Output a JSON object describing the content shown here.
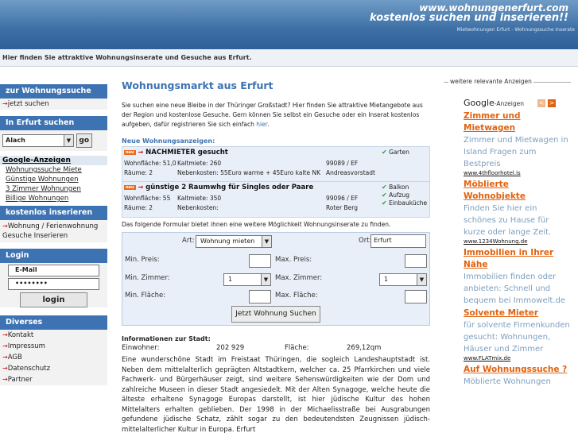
{
  "header": {
    "domain": "www.wohnungenerfurt.com",
    "slogan": "kostenlos suchen und inserieren!!",
    "tagline": "Mietwohnungen Erfurt - Wohnungssuche Inserate",
    "subtitle": "Hier finden Sie attraktive Wohnungsinserate und Gesuche aus Erfurt."
  },
  "sidebar": {
    "search": {
      "title": "zur Wohnungssuche",
      "link": "jetzt suchen"
    },
    "city": {
      "title": "In Erfurt suchen",
      "selected": "Alach",
      "go": "go"
    },
    "google": {
      "title": "Google-Anzeigen",
      "links": [
        "Wohnungssuche Miete",
        "Günstige Wohnungen",
        "3 Zimmer Wohnungen",
        "Billige Wohnungen"
      ]
    },
    "insert": {
      "title": "kostenlos inserieren",
      "link": "Wohnung / Ferienwohnung Gesuche Inserieren"
    },
    "login": {
      "title": "Login",
      "email_placeholder": "E-Mail",
      "password": "••••••••",
      "button": "login"
    },
    "misc": {
      "title": "Diverses",
      "links": [
        "Kontakt",
        "Impressum",
        "AGB",
        "Datenschutz",
        "Partner"
      ]
    }
  },
  "main": {
    "title": "Wohnungsmarkt aus Erfurt",
    "intro": "Sie suchen eine neue Bleibe in der Thüringer Großstadt? Hier finden Sie attraktive Mietangebote aus der Region und kostenlose Gesuche. Gern können Sie selbst ein Gesuche oder ein Inserat kostenlos aufgeben, dafür registrieren Sie sich einfach",
    "intro_link": "hier",
    "intro_end": ".",
    "new_heading": "Neue Wohnungsanzeigen:",
    "badge": "neu",
    "listings": [
      {
        "title": "NACHMIETER gesucht",
        "wohnflaeche": "Wohnfläche: 51,0",
        "kaltmiete": "Kaltmiete: 260",
        "raeume": "Räume: 2",
        "nebenkosten": "Nebenkosten: 55Euro warme + 45Euro kalte NK",
        "plz": "99089 / EF",
        "ort": "Andreasvorstadt",
        "features": [
          "Garten"
        ]
      },
      {
        "title": "günstige 2 Raumwhg für Singles oder Paare",
        "wohnflaeche": "Wohnfläche: 55",
        "kaltmiete": "Kaltmiete: 350",
        "raeume": "Räume: 2",
        "nebenkosten": "Nebenkosten:",
        "plz": "99096 / EF",
        "ort": "Roter Berg",
        "features": [
          "Balkon",
          "Aufzug",
          "Einbauküche"
        ]
      }
    ],
    "form_intro": "Das folgende Formular bietet ihnen eine weitere Möglichkeit Wohnungsinserate zu finden.",
    "form": {
      "art_label": "Art:",
      "art_value": "Wohnung mieten",
      "ort_label": "Ort:",
      "ort_value": "Erfurt",
      "min_preis": "Min. Preis:",
      "max_preis": "Max. Preis:",
      "min_zimmer": "Min. Zimmer:",
      "min_zimmer_value": "1",
      "max_zimmer": "Max. Zimmer:",
      "max_zimmer_value": "1",
      "min_flaeche": "Min. Fläche:",
      "max_flaeche": "Max. Fläche:",
      "submit": "Jetzt Wohnung Suchen"
    },
    "info_heading": "Informationen zur Stadt:",
    "einwohner_label": "Einwohner:",
    "einwohner_value": "202 929",
    "flaeche_label": "Fläche:",
    "flaeche_value": "269,12qm",
    "info_text": "Eine wunderschöne Stadt im Freistaat Thüringen, die sogleich Landeshauptstadt ist. Neben dem mittelalterlich geprägten Altstadtkern, welcher ca. 25 Pfarrkirchen und viele Fachwerk- und Bürgerhäuser zeigt, sind weitere Sehenswürdigkeiten wie der Dom und zahlreiche Museen in dieser Stadt angesiedelt. Mit der Alten Synagoge, welche heute die älteste erhaltene Synagoge Europas darstellt, ist hier jüdische Kultur des hohen Mittelalters erhalten geblieben. Der 1998 in der Michaelisstraße bei Ausgrabungen gefundene jüdische Schatz, zählt sogar zu den bedeutendsten Zeugnissen jüdisch-mittelalterlicher Kultur in Europa. Erfurt"
  },
  "ads": {
    "legend": "weitere relevante Anzeigen",
    "google": "Google",
    "google_suffix": "-Anzeigen",
    "prev": "<",
    "next": ">",
    "items": [
      {
        "headline": "Zimmer und Mietwagen",
        "text": "Zimmer und Mietwagen in Island Fragen zum Bestpreis",
        "url": "www.4thfloorhotel.is"
      },
      {
        "headline": "Möblierte Wohnobjekte",
        "text": "Finden Sie hier ein schönes zu Hause für kurze oder lange Zeit.",
        "url": "www.1234Wohnung.de"
      },
      {
        "headline": "Immobilien in Ihrer Nähe",
        "text": "Immobilien finden oder anbieten: Schnell und bequem bei Immowelt.de",
        "url": ""
      },
      {
        "headline": "Solvente Mieter",
        "text": "für solvente Firmenkunden gesucht: Wohnungen, Häuser und Zimmer",
        "url": "www.FLATmix.de"
      },
      {
        "headline": "Auf Wohnungssuche ?",
        "text": "Möblierte Wohnungen",
        "url": ""
      }
    ]
  },
  "colors": {
    "accent": "#3d73b3",
    "ad_headline": "#e0620f",
    "header_bg": "#3d6fa5"
  }
}
